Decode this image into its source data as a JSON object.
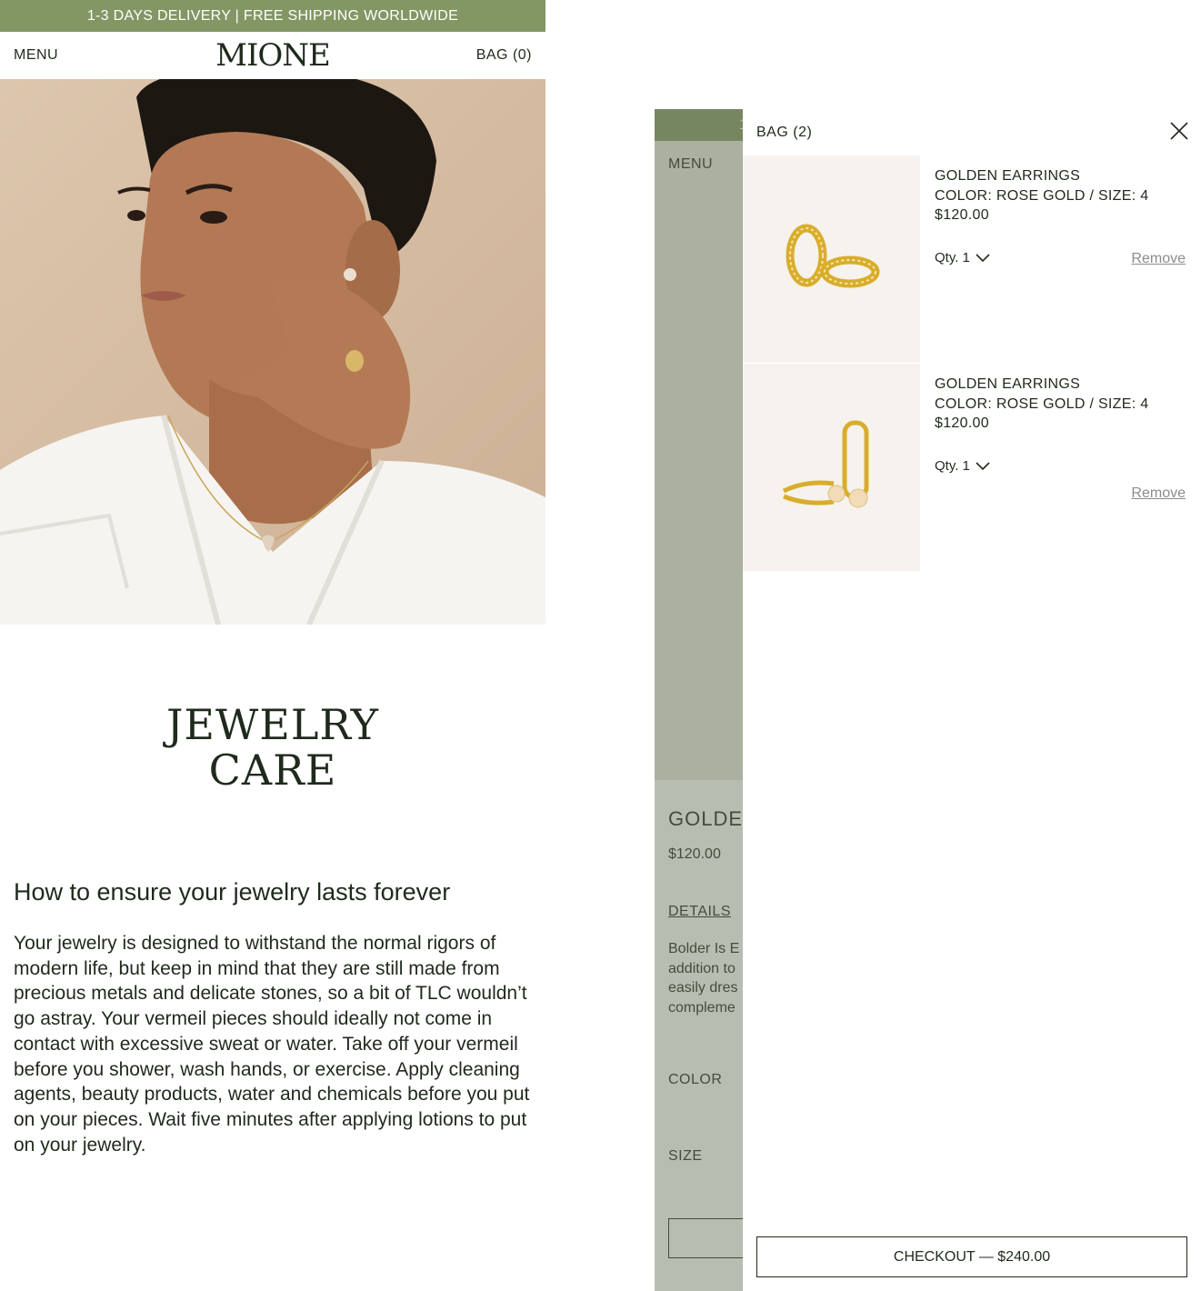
{
  "left_screen": {
    "promo_text": "1-3 DAYS DELIVERY | FREE SHIPPING WORLDWIDE",
    "header": {
      "menu_label": "MENU",
      "logo": "MIONE",
      "bag_label": "BAG (0)"
    },
    "page_title_line1": "JEWELRY",
    "page_title_line2": "CARE",
    "subheading": "How to ensure your jewelry lasts forever",
    "body": "Your jewelry is designed to withstand the normal rigors of modern life, but keep in mind that they are still made from precious metals and delicate stones, so a bit of TLC wouldn’t go astray. Your vermeil pieces should ideally not come in contact with excessive sweat or water.  Take off your vermeil before you shower, wash hands, or exercise. Apply cleaning agents, beauty products, water and chemicals before you put on your pieces. Wait five minutes after applying lotions to put on your jewelry."
  },
  "right_screen": {
    "background_page": {
      "promo_fragment": "1",
      "menu_label": "MENU",
      "product_title_fragment": "GOLDE",
      "price": "$120.00",
      "details_label": "DETAILS",
      "description_lines": [
        "Bolder Is E",
        "addition to",
        "easily dres",
        "compleme"
      ],
      "color_label": "COLOR",
      "size_label": "SIZE"
    },
    "bag_drawer": {
      "title": "BAG (2)",
      "items": [
        {
          "name": "GOLDEN EARRINGS",
          "variant": "COLOR: ROSE GOLD / SIZE: 4",
          "price": "$120.00",
          "qty_label": "Qty. 1",
          "remove_label": "Remove"
        },
        {
          "name": "GOLDEN EARRINGS",
          "variant": "COLOR: ROSE GOLD / SIZE: 4",
          "price": "$120.00",
          "qty_label": "Qty. 1",
          "remove_label": "Remove"
        }
      ],
      "checkout_label": "CHECKOUT — $240.00"
    }
  },
  "colors": {
    "promo_bar": "#839765",
    "text_dark": "#1f2a1c",
    "thumb_bg": "#f6f2ed",
    "overlay": "#b5bbad"
  },
  "icons": [
    "close-icon",
    "chevron-down-icon"
  ]
}
